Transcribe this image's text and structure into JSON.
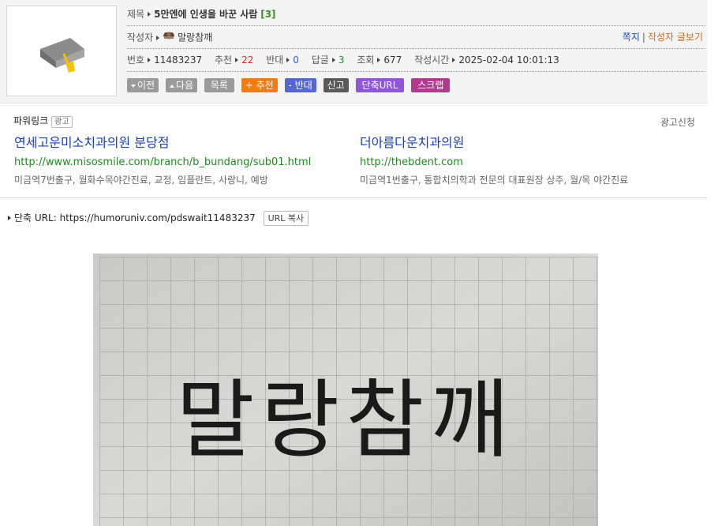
{
  "post": {
    "title_label": "제목",
    "title": "5만엔에 인생을 바꾼 사람",
    "comment_count": "[3]",
    "author_label": "작성자",
    "author_icon": "dog-icon",
    "author": "말랑참깨",
    "message_link": "쪽지",
    "link_separator": "|",
    "author_posts_link": "작성자 글보기",
    "number_label": "번호",
    "number": "11483237",
    "recommend_label": "추천",
    "recommend": "22",
    "oppose_label": "반대",
    "oppose": "0",
    "reply_label": "답글",
    "reply": "3",
    "views_label": "조회",
    "views": "677",
    "date_label": "작성시간",
    "date": "2025-02-04 10:01:13"
  },
  "buttons": {
    "prev": "이전",
    "next": "다음",
    "list": "목록",
    "recommend": "+ 추천",
    "oppose": "- 반대",
    "report": "신고",
    "short_url": "단축URL",
    "scrap": "스크랩"
  },
  "ads": {
    "title": "파워링크",
    "badge": "광고",
    "apply": "광고신청",
    "items": [
      {
        "title": "연세고운미소치과의원 분당점",
        "url": "http://www.misosmile.com/branch/b_bundang/sub01.html",
        "desc": "미금역7번출구, 월화수목야간진료, 교정, 임플란트, 사랑니, 예방"
      },
      {
        "title": "더아름다운치과의원",
        "url": "http://thebdent.com",
        "desc": "미금역1번출구, 통합치의학과 전문의 대표원장 상주, 월/목 야간진료"
      }
    ]
  },
  "short_url": {
    "label": "단축 URL:",
    "url": "https://humoruniv.com/pdswait11483237",
    "copy": "URL 복사"
  },
  "photo": {
    "handwriting": "말랑참깨"
  },
  "colors": {
    "header_bg": "#f4f4f4",
    "comment_green": "#3a8d2c",
    "recommend_red": "#e0201f",
    "ad_title_blue": "#1a3fb0",
    "ad_url_green": "#1f8a1f",
    "author_link": "#d2691e"
  }
}
